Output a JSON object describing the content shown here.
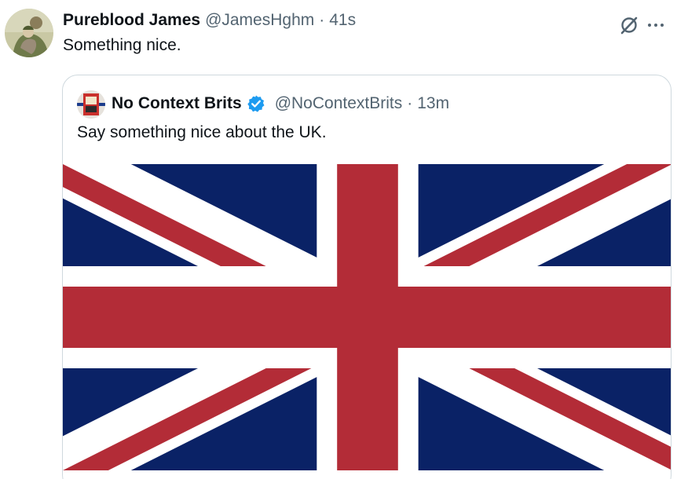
{
  "tweet": {
    "display_name": "Pureblood James",
    "handle": "@JamesHghm",
    "separator": "·",
    "time": "41s",
    "text": "Something nice."
  },
  "quoted_tweet": {
    "display_name": "No Context Brits",
    "handle": "@NoContextBrits",
    "separator": "·",
    "time": "13m",
    "text": "Say something nice about the UK.",
    "media": {
      "description": "union-jack-flag",
      "colors": {
        "blue": "#0a2266",
        "red": "#b32c37",
        "white": "#ffffff"
      }
    }
  },
  "icons": {
    "grok": "grok-icon",
    "more": "more-icon",
    "verified": "verified-badge-icon"
  },
  "colors": {
    "text_primary": "#0f1419",
    "text_secondary": "#536471",
    "verified_blue": "#1d9bf0",
    "border": "#cfd9de"
  }
}
